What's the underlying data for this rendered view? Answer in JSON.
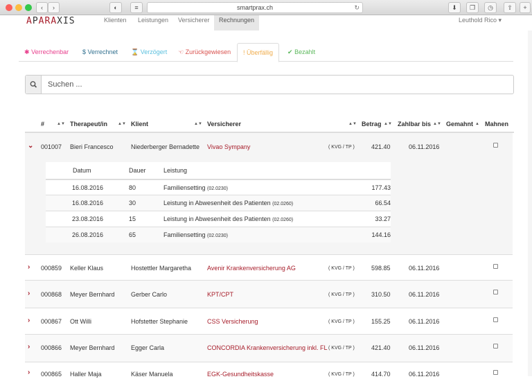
{
  "browser": {
    "url": "smartprax.ch"
  },
  "app": {
    "logo_letters": [
      "A",
      "P",
      "A",
      "R",
      "A",
      "X",
      "I",
      "S"
    ],
    "nav": [
      "Klienten",
      "Leistungen",
      "Versicherer",
      "Rechnungen"
    ],
    "user": "Leuthold Rico ▾"
  },
  "status_tabs": [
    {
      "icon": "✱",
      "label": "Verrechenbar",
      "color": "#e83e8c"
    },
    {
      "icon": "$",
      "label": "Verrechnet",
      "color": "#31708f"
    },
    {
      "icon": "⌛",
      "label": "Verzögert",
      "color": "#5bc0de"
    },
    {
      "icon": "☜",
      "label": "Zurückgewiesen",
      "color": "#d9534f"
    },
    {
      "icon": "!",
      "label": "Überfällig",
      "color": "#f0ad4e"
    },
    {
      "icon": "✔",
      "label": "Bezahlt",
      "color": "#5cb85c"
    }
  ],
  "search": {
    "placeholder": "Suchen ..."
  },
  "table": {
    "headers": {
      "num": "#",
      "therapist": "Therapeut/in",
      "client": "Klient",
      "insurer": "Versicherer",
      "amount": "Betrag",
      "due": "Zahlbar bis",
      "dunned": "Gemahnt",
      "dun": "Mahnen"
    },
    "rows": [
      {
        "num": "001007",
        "therapist": "Bieri Francesco",
        "client": "Niederberger Bernadette",
        "insurer": "Vivao Sympany",
        "law": "( KVG / TP )",
        "amount": "421.40",
        "due": "06.11.2016",
        "expanded": true
      },
      {
        "num": "000859",
        "therapist": "Keller Klaus",
        "client": "Hostettler Margaretha",
        "insurer": "Avenir Krankenversicherung AG",
        "law": "( KVG / TP )",
        "amount": "598.85",
        "due": "06.11.2016"
      },
      {
        "num": "000868",
        "therapist": "Meyer Bernhard",
        "client": "Gerber Carlo",
        "insurer": "KPT/CPT",
        "law": "( KVG / TP )",
        "amount": "310.50",
        "due": "06.11.2016"
      },
      {
        "num": "000867",
        "therapist": "Ott Willi",
        "client": "Hofstetter Stephanie",
        "insurer": "CSS Versicherung",
        "law": "( KVG / TP )",
        "amount": "155.25",
        "due": "06.11.2016"
      },
      {
        "num": "000866",
        "therapist": "Meyer Bernhard",
        "client": "Egger Carla",
        "insurer": "CONCORDIA Krankenversicherung inkl. FL",
        "law": "( KVG / TP )",
        "amount": "421.40",
        "due": "06.11.2016"
      },
      {
        "num": "000865",
        "therapist": "Haller Maja",
        "client": "Käser Manuela",
        "insurer": "EGK-Gesundheitskasse",
        "law": "( KVG / TP )",
        "amount": "414.70",
        "due": "06.11.2016"
      }
    ],
    "detail": {
      "headers": {
        "date": "Datum",
        "duration": "Dauer",
        "service": "Leistung"
      },
      "items": [
        {
          "date": "16.08.2016",
          "duration": "80",
          "service": "Familiensetting",
          "code": "(02.0230)",
          "amount": "177.43"
        },
        {
          "date": "16.08.2016",
          "duration": "30",
          "service": "Leistung in Abwesenheit des Patienten",
          "code": "(02.0260)",
          "amount": "66.54"
        },
        {
          "date": "23.08.2016",
          "duration": "15",
          "service": "Leistung in Abwesenheit des Patienten",
          "code": "(02.0260)",
          "amount": "33.27"
        },
        {
          "date": "26.08.2016",
          "duration": "65",
          "service": "Familiensetting",
          "code": "(02.0230)",
          "amount": "144.16"
        }
      ]
    }
  }
}
